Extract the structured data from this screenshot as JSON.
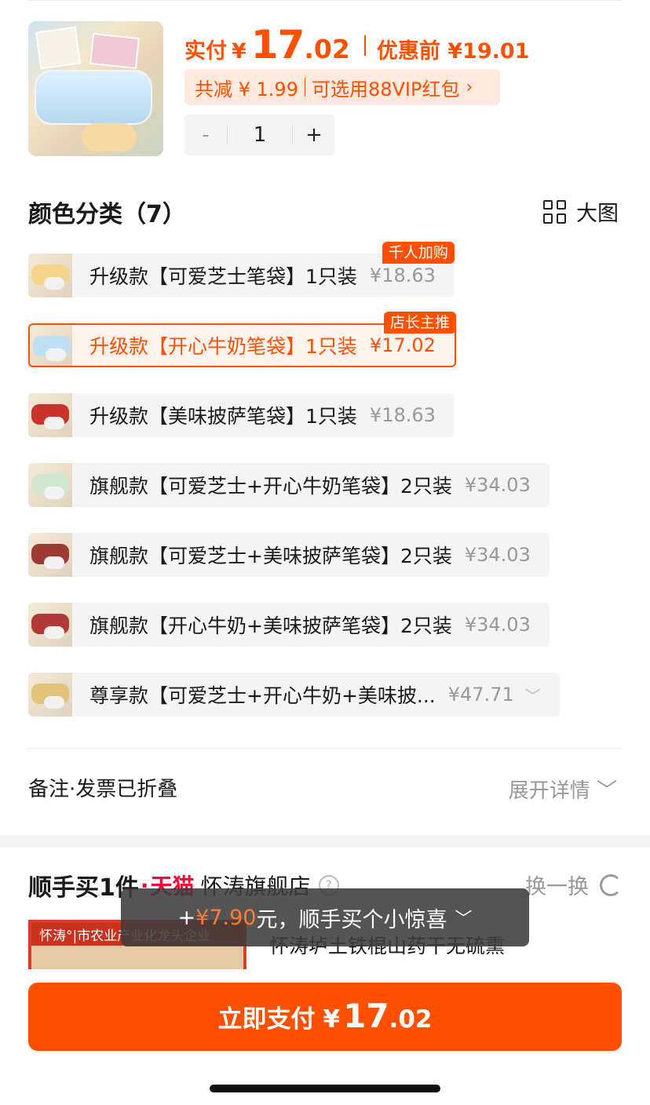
{
  "header": {
    "paid_label": "实付",
    "currency": "¥",
    "paid_int": "17",
    "paid_dec": ".02",
    "orig_label": "优惠前 ¥19.01",
    "discount_text": "共减 ¥ 1.99",
    "vip_text": "可选用88VIP红包",
    "chevron": "›",
    "quantity": "1",
    "minus": "-",
    "plus": "+"
  },
  "section": {
    "title": "颜色分类（7）",
    "big_image_label": "大图"
  },
  "options": [
    {
      "name": "升级款【可爱芝士笔袋】1只装",
      "price": "¥18.63",
      "tag": "千人加购",
      "color": "#f4d58a"
    },
    {
      "name": "升级款【开心牛奶笔袋】1只装",
      "price": "¥17.02",
      "tag": "店长主推",
      "color": "#bfe0f2"
    },
    {
      "name": "升级款【美味披萨笔袋】1只装",
      "price": "¥18.63",
      "tag": "",
      "color": "#c8342c"
    },
    {
      "name": "旗舰款【可爱芝士+开心牛奶笔袋】2只装",
      "price": "¥34.03",
      "tag": "",
      "color": "#cfe6cf"
    },
    {
      "name": "旗舰款【可爱芝士+美味披萨笔袋】2只装",
      "price": "¥34.03",
      "tag": "",
      "color": "#9c3a33"
    },
    {
      "name": "旗舰款【开心牛奶+美味披萨笔袋】2只装",
      "price": "¥34.03",
      "tag": "",
      "color": "#b23a36"
    },
    {
      "name": "尊享款【可爱芝士+开心牛奶+美味披...",
      "price": "¥47.71",
      "tag": "",
      "color": "#e3c27a"
    }
  ],
  "remark": {
    "label": "备注·发票已折叠",
    "expand_label": "展开详情 ﹀"
  },
  "addon": {
    "title": "顺手买1件",
    "dot": "·",
    "platform": "天猫",
    "shop": "怀涛旗舰店",
    "help": "?",
    "swap_label": "换一换",
    "image_header": "怀涛°|市农业产业化龙头企业",
    "product_name": "怀涛垆土铁棍山药干无硫熏",
    "toast_prefix": "+",
    "toast_amount": "¥7.90",
    "toast_suffix": "元，顺手买个小惊喜",
    "toast_icon": "﹀"
  },
  "pay": {
    "label": "立即支付",
    "currency": "¥",
    "int": "17",
    "dec": ".02"
  },
  "colors": {
    "accent": "#ff5000",
    "tmall": "#ff0036"
  }
}
